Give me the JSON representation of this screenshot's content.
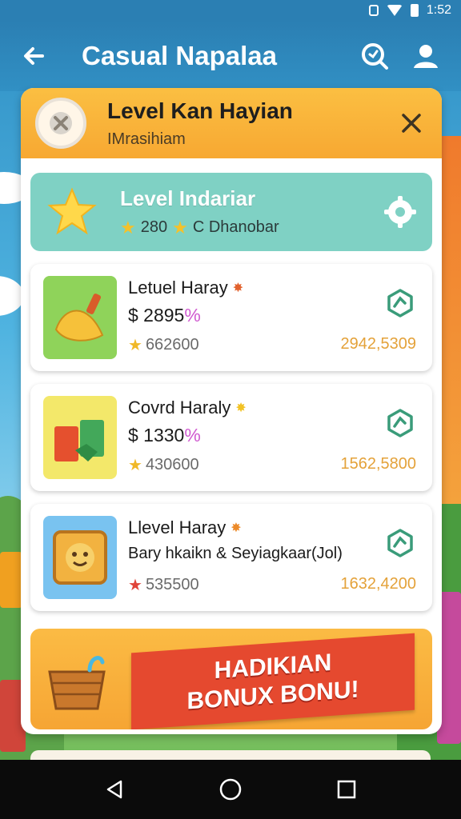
{
  "status_bar": {
    "time": "1:52"
  },
  "app_bar": {
    "title": "Casual Napalaa"
  },
  "panel": {
    "header_title": "Level Kan Hayian",
    "header_subtitle": "IMrasihiam"
  },
  "featured": {
    "title": "Level Indariar",
    "score": "280",
    "meta_label": "C Dhanobar"
  },
  "items": [
    {
      "title": "Letuel Haray",
      "price": "$ 2895",
      "price_suffix": "%",
      "score": "662600",
      "value": "2942,5309"
    },
    {
      "title": "Covrd Haraly",
      "price": "$ 1330",
      "price_suffix": "%",
      "score": "430600",
      "value": "1562,5800"
    },
    {
      "title": "Llevel Haray",
      "price": "Bary hkaikn & Seyiagkaar(Jol)",
      "price_suffix": "",
      "score": "535500",
      "value": "1632,4200"
    }
  ],
  "bonus": {
    "line1": "HADIKIAN",
    "line2": "BONUX BONU!"
  },
  "colors": {
    "accent_orange": "#f7a832",
    "teal": "#7fd1c4",
    "ribbon_red": "#e5492f",
    "action_green": "#3a9c7a"
  }
}
